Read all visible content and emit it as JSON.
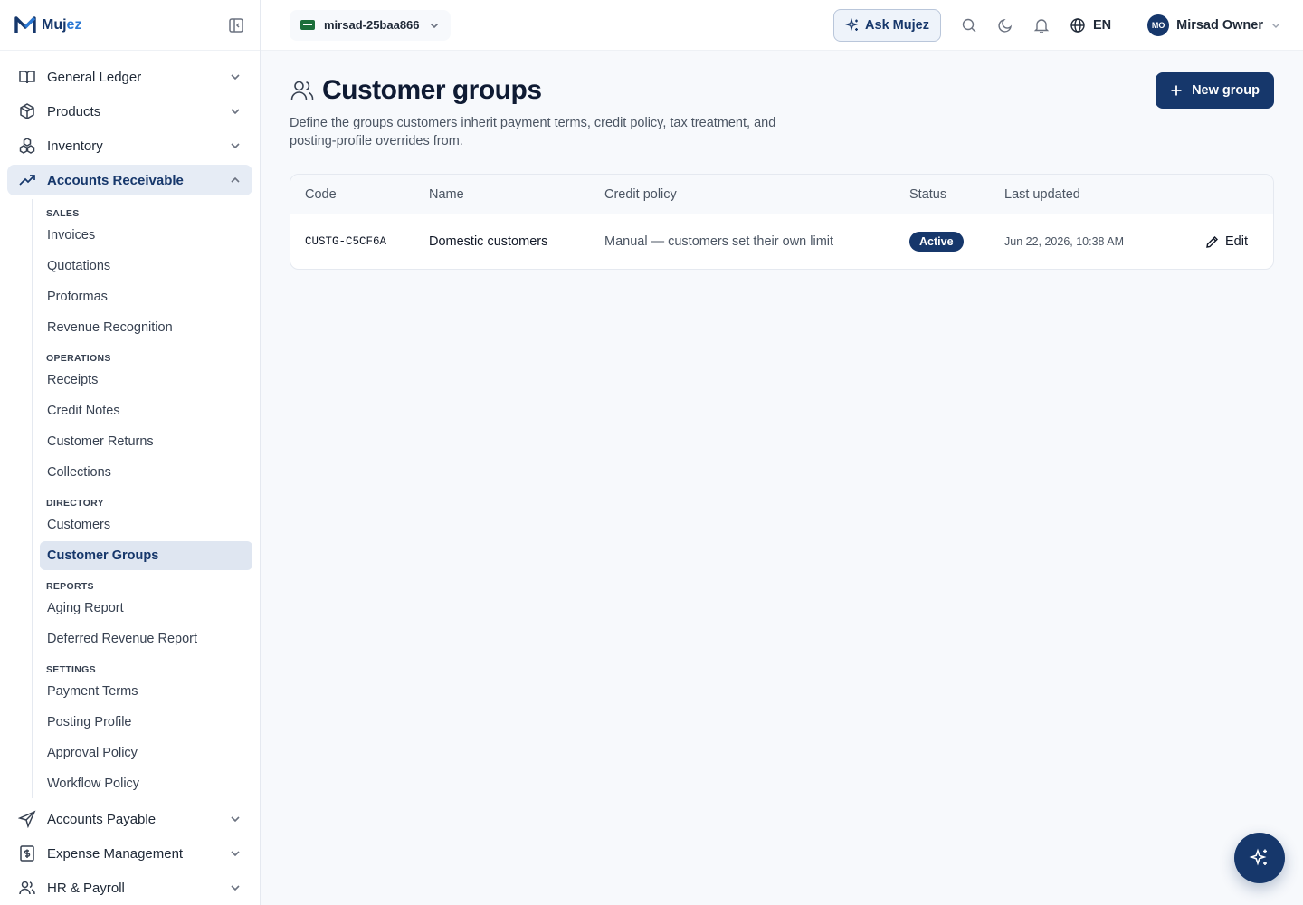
{
  "brand": {
    "name_a": "Muj",
    "name_b": "ez"
  },
  "sidebar": {
    "top_items": [
      {
        "label": "General Ledger",
        "icon": "book-icon"
      },
      {
        "label": "Products",
        "icon": "box-icon"
      },
      {
        "label": "Inventory",
        "icon": "boxes-icon"
      }
    ],
    "active_item": {
      "label": "Accounts Receivable",
      "icon": "trending-up-icon"
    },
    "sections": [
      {
        "heading": "SALES",
        "items": [
          "Invoices",
          "Quotations",
          "Proformas",
          "Revenue Recognition"
        ]
      },
      {
        "heading": "OPERATIONS",
        "items": [
          "Receipts",
          "Credit Notes",
          "Customer Returns",
          "Collections"
        ]
      },
      {
        "heading": "DIRECTORY",
        "items": [
          "Customers",
          "Customer Groups"
        ]
      },
      {
        "heading": "REPORTS",
        "items": [
          "Aging Report",
          "Deferred Revenue Report"
        ]
      },
      {
        "heading": "SETTINGS",
        "items": [
          "Payment Terms",
          "Posting Profile",
          "Approval Policy",
          "Workflow Policy"
        ]
      }
    ],
    "active_sub_item": "Customer Groups",
    "bottom_items": [
      {
        "label": "Accounts Payable",
        "icon": "send-icon"
      },
      {
        "label": "Expense Management",
        "icon": "receipt-icon"
      },
      {
        "label": "HR & Payroll",
        "icon": "users-icon"
      }
    ]
  },
  "topbar": {
    "tenant": "mirsad-25baa866",
    "ask_label": "Ask Mujez",
    "language": "EN",
    "user_initials": "MO",
    "user_name": "Mirsad Owner"
  },
  "page": {
    "title": "Customer groups",
    "description": "Define the groups customers inherit payment terms, credit policy, tax treatment, and posting-profile overrides from.",
    "new_button": "New group"
  },
  "table": {
    "columns": {
      "code": "Code",
      "name": "Name",
      "credit": "Credit policy",
      "status": "Status",
      "updated": "Last updated"
    },
    "rows": [
      {
        "code": "CUSTG-C5CF6A",
        "name": "Domestic customers",
        "credit": "Manual — customers set their own limit",
        "status": "Active",
        "updated": "Jun 22, 2026, 10:38 AM",
        "action": "Edit"
      }
    ]
  },
  "colors": {
    "primary": "#16376b",
    "accent": "#2a78d4",
    "active_bg": "#e6ecf5"
  }
}
